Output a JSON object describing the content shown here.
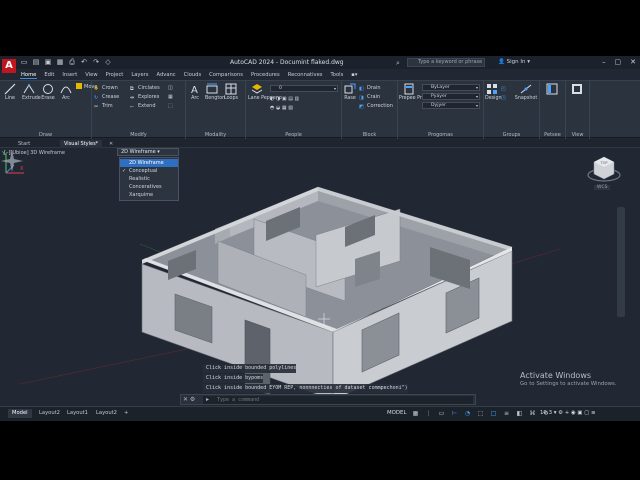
{
  "window": {
    "logo": "A",
    "title": "AutoCAD 2024 - Documint flaked.dwg",
    "search_placeholder": "Type a keyword or phrase",
    "signin": "Sign In"
  },
  "menu_tabs": [
    "Home",
    "Edit",
    "Insert",
    "View",
    "Project",
    "Layers",
    "Advanc",
    "Clouds",
    "Comparisons",
    "Procedures",
    "Reconnatives",
    "Tools"
  ],
  "ribbon": {
    "draw": {
      "title": "Draw",
      "line": "Line",
      "extrude": "Extrude",
      "erase": "Erase",
      "arc": "Arc",
      "move": "Move",
      "copy": "Copy",
      "stretch": "Stretch"
    },
    "modify": {
      "title": "Modify",
      "crown": "Crown",
      "crease": "Crease",
      "trim": "Trim",
      "circles": "Circlates",
      "explores": "Explores",
      "extend": "Extend"
    },
    "modality": {
      "title": "Modality",
      "arc": "Arc",
      "bengton": "Bengton",
      "loops": "Loops"
    },
    "people": {
      "title": "People",
      "layer_props": "Lane Peppeno",
      "layer_value": "0"
    },
    "block": {
      "title": "Block",
      "insert": "Rase",
      "drain": "Drain",
      "create": "Crain",
      "correction": "Correction"
    },
    "properties": {
      "title": "Progomas",
      "match": "Prepee Projects",
      "layer": "ByLayer",
      "color": "Pyayer",
      "linetype": "Dyjyer"
    },
    "groups": {
      "title": "Groups",
      "design": "Design",
      "snapshot": "Snapshot"
    },
    "palettes": {
      "title": "Petsee"
    },
    "view": {
      "title": "View"
    }
  },
  "file_tabs": [
    "Start",
    "Visual Styles*"
  ],
  "viewport": {
    "label": "[–][Ubioe] 3D Wireframe",
    "visual_style_current": "2D Wireframe",
    "visual_styles": [
      "2D Wireframe",
      "Conceptual",
      "Realistic",
      "Conceratives",
      "Xarquime"
    ],
    "selected_index": 0,
    "checked_index": 1
  },
  "viewcube": {
    "face": "TOP",
    "wcs": "WCS"
  },
  "command_history": [
    "Click inside bounded polylines",
    "Click inside bypoms",
    "Click inside bounded EYOM REP, nonnnecties of dataset commpechoni\")"
  ],
  "command_line": {
    "placeholder": "Type a command"
  },
  "watermark": {
    "title": "Activate Windows",
    "subtitle": "Go to Settings to activate Windows."
  },
  "layout_tabs": [
    "Model",
    "Layout2",
    "Layout1",
    "Layout2"
  ],
  "status": {
    "model": "MODEL",
    "scale": "10.3"
  }
}
